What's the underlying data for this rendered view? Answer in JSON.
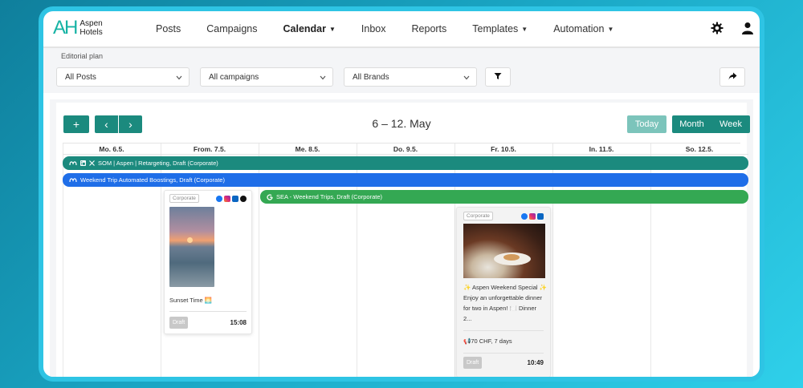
{
  "brand": {
    "mark": "AH",
    "line1": "Aspen",
    "line2": "Hotels"
  },
  "nav": {
    "items": [
      {
        "label": "Posts"
      },
      {
        "label": "Campaigns"
      },
      {
        "label": "Calendar",
        "active": true,
        "dropdown": true
      },
      {
        "label": "Inbox"
      },
      {
        "label": "Reports"
      },
      {
        "label": "Templates",
        "dropdown": true
      },
      {
        "label": "Automation",
        "dropdown": true
      }
    ],
    "icons": [
      "gear-icon",
      "user-icon"
    ]
  },
  "filters": {
    "title": "Editorial plan",
    "posts": "All Posts",
    "campaigns": "All campaigns",
    "brands": "All Brands"
  },
  "toolbar": {
    "add": "+",
    "prev": "‹",
    "next": "›",
    "range": "6 – 12. May",
    "today": "Today",
    "month": "Month",
    "week": "Week"
  },
  "days": [
    "Mo. 6.5.",
    "From. 7.5.",
    "Me. 8.5.",
    "Do. 9.5.",
    "Fr. 10.5.",
    "In. 11.5.",
    "So. 12.5."
  ],
  "campaigns": [
    {
      "label": "SOM | Aspen | Retargeting, Draft (Corporate)",
      "color": "#1b8a7e"
    },
    {
      "label": "Weekend Trip Automated Boostings, Draft (Corporate)",
      "color": "#1f6ee8"
    },
    {
      "label": "SEA - Weekend Trips, Draft (Corporate)",
      "color": "#34a853"
    }
  ],
  "posts": [
    {
      "tag": "Corporate",
      "caption": "Sunset Time 🌅",
      "status": "Draft",
      "time": "15:08"
    },
    {
      "tag": "Corporate",
      "line1": "✨ Aspen Weekend Special ✨",
      "line2": "Enjoy an unforgettable dinner",
      "line3": "for two in Aspen! 🍽️ Dinner",
      "line4": "2...",
      "budget": "📢70 CHF, 7 days",
      "status": "Draft",
      "time": "10:49"
    }
  ]
}
